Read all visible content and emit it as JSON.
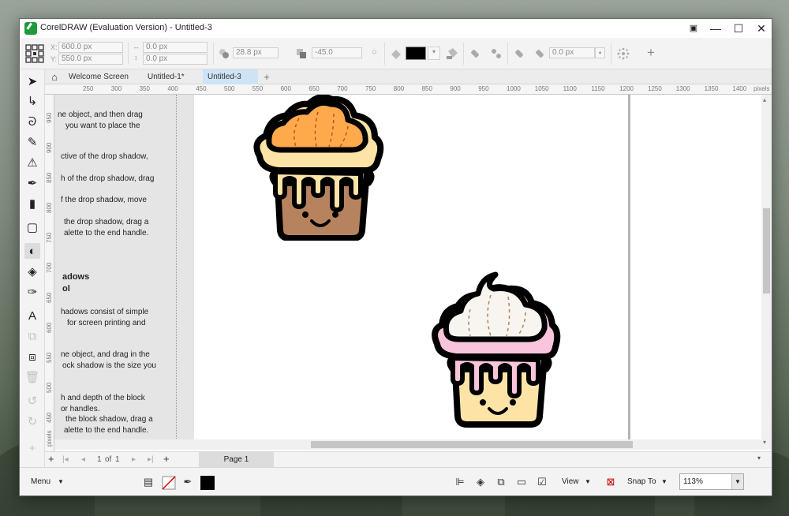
{
  "window": {
    "title": "CorelDRAW (Evaluation Version) - Untitled-3",
    "controls": {
      "help": "▣",
      "minimize": "—",
      "maximize": "☐",
      "close": "✕"
    }
  },
  "propbar": {
    "x_label": "X:",
    "x_value": "600.0 px",
    "y_label": "Y:",
    "y_value": "550.0 px",
    "w_value": "0.0 px",
    "h_value": "0.0 px",
    "shadow_offset": "28.8 px",
    "angle": "-45.0",
    "color_hex": "#000000",
    "extra_value": "0.0 px",
    "add": "+"
  },
  "tabs": [
    {
      "label": "Welcome Screen"
    },
    {
      "label": "Untitled-1*"
    },
    {
      "label": "Untitled-3"
    }
  ],
  "hruler": {
    "labels": [
      "250",
      "300",
      "350",
      "400",
      "450",
      "500",
      "550",
      "600",
      "650",
      "700",
      "750",
      "800",
      "850",
      "900",
      "950",
      "1000",
      "1050",
      "1100",
      "1150",
      "1200",
      "1250",
      "1300",
      "1350",
      "1400"
    ],
    "unit": "pixels"
  },
  "vruler": {
    "labels": [
      "950",
      "900",
      "850",
      "800",
      "750",
      "700",
      "650",
      "600",
      "550",
      "500",
      "450"
    ],
    "unit": "pixels"
  },
  "help_panel": {
    "lines": [
      "ne object, and then drag",
      "you want to place the",
      "ctive of the drop shadow,",
      "h of the drop shadow, drag",
      "f the drop shadow, move",
      "the drop shadow, drag a",
      "alette to the end handle.",
      "adows",
      "ol",
      "hadows consist of simple",
      "for screen printing and",
      "ne object, and drag in the",
      "ock shadow is the size you",
      "h and depth of the block",
      "or handles.",
      "the block shadow, drag a",
      "alette to the end handle."
    ]
  },
  "pagebar": {
    "page_current": "1",
    "page_of": "of",
    "page_total": "1",
    "page_tab": "Page 1"
  },
  "status": {
    "menu": "Menu",
    "view": "View",
    "snap_to": "Snap To",
    "zoom": "113%"
  },
  "colors": {
    "accent_tab": "#cfe3f7",
    "cupcake1_frosting": "#ffa94d",
    "cupcake1_icing": "#fde4a6",
    "cupcake1_base": "#b7835e",
    "cupcake2_frosting": "#f8f4f0",
    "cupcake2_icing": "#f9c5dc",
    "cupcake2_base": "#fde4a6"
  }
}
